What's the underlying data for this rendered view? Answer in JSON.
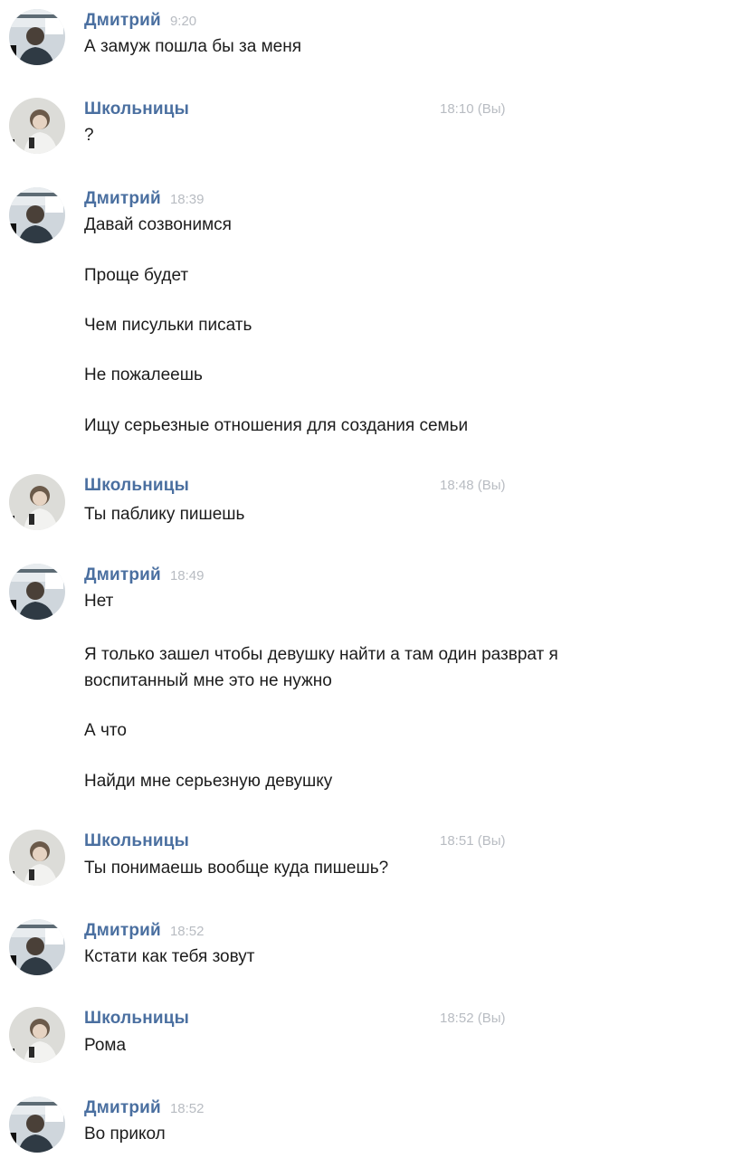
{
  "messages": [
    {
      "author": "Дмитрий",
      "time": "9:20",
      "mine": false,
      "lines": [
        "А замуж пошла бы за меня"
      ]
    },
    {
      "author": "Школьницы",
      "time": "18:10 (Вы)",
      "mine": true,
      "lines": [
        "?"
      ]
    },
    {
      "author": "Дмитрий",
      "time": "18:39",
      "mine": false,
      "lines": [
        "Давай созвонимся",
        "Проще будет",
        "Чем писульки писать",
        "Не пожалеешь",
        "Ищу серьезные отношения для создания семьи"
      ]
    },
    {
      "author": "Школьницы",
      "time": "18:48 (Вы)",
      "mine": true,
      "lines": [
        "Ты паблику пишешь"
      ]
    },
    {
      "author": "Дмитрий",
      "time": "18:49",
      "mine": false,
      "lines": [
        "Нет",
        "Я только зашел чтобы девушку найти а там один разврат я",
        "воспитанный мне это не нужно",
        "А что",
        "Найди мне серьезную девушку"
      ]
    },
    {
      "author": "Школьницы",
      "time": "18:51 (Вы)",
      "mine": true,
      "lines": [
        "Ты понимаешь вообще куда пишешь?"
      ]
    },
    {
      "author": "Дмитрий",
      "time": "18:52",
      "mine": false,
      "lines": [
        "Кстати как тебя зовут"
      ]
    },
    {
      "author": "Школьницы",
      "time": "18:52 (Вы)",
      "mine": true,
      "lines": [
        "Рома"
      ]
    },
    {
      "author": "Дмитрий",
      "time": "18:52",
      "mine": false,
      "lines": [
        "Во прикол"
      ]
    }
  ]
}
